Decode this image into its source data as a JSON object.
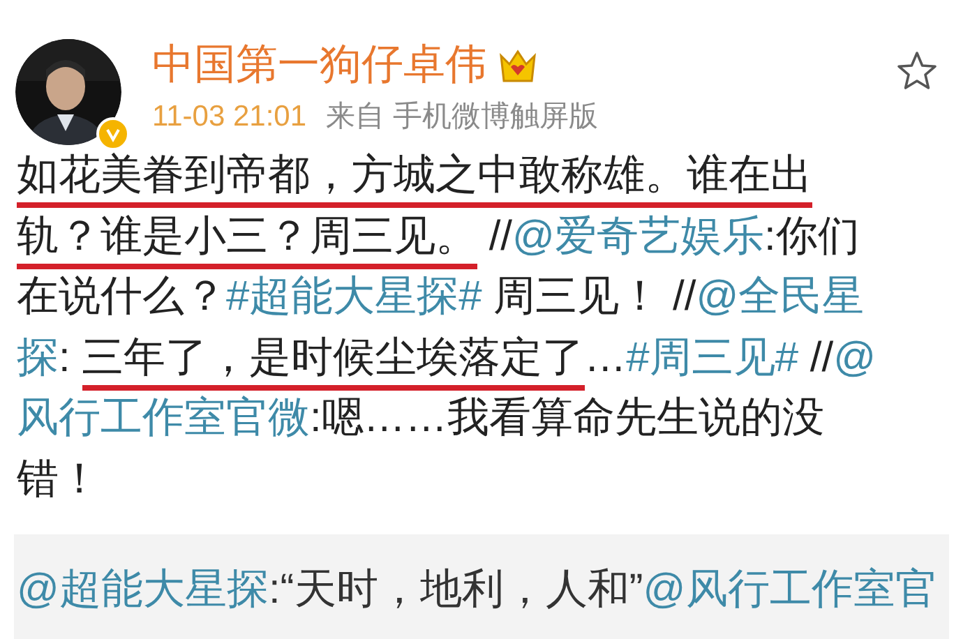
{
  "post": {
    "author": "中国第一狗仔卓伟",
    "time": "11-03 21:01",
    "source": "来自 手机微博触屏版",
    "verified": true,
    "lines": [
      [
        {
          "kind": "text",
          "text": "如花美眷到帝都，方城之中敢称雄。谁在出",
          "underlined": true
        }
      ],
      [
        {
          "kind": "text",
          "text": "轨？谁是小三？周三见。",
          "underlined": true
        },
        {
          "kind": "text",
          "text": " //",
          "underlined": false
        },
        {
          "kind": "link",
          "text": "@爱奇艺娱乐",
          "underlined": false
        },
        {
          "kind": "text",
          "text": ":你们",
          "underlined": false
        }
      ],
      [
        {
          "kind": "text",
          "text": "在说什么？",
          "underlined": false
        },
        {
          "kind": "link",
          "text": "#超能大星探#",
          "underlined": false
        },
        {
          "kind": "text",
          "text": " 周三见！ //",
          "underlined": false
        },
        {
          "kind": "link",
          "text": "@全民星",
          "underlined": false
        }
      ],
      [
        {
          "kind": "link",
          "text": "探",
          "underlined": false
        },
        {
          "kind": "text",
          "text": ": ",
          "underlined": false
        },
        {
          "kind": "text",
          "text": "三年了，是时候尘埃落定了",
          "underlined": true
        },
        {
          "kind": "text",
          "text": "…",
          "underlined": false
        },
        {
          "kind": "link",
          "text": "#周三见#",
          "underlined": false
        },
        {
          "kind": "text",
          "text": " //",
          "underlined": false
        },
        {
          "kind": "link",
          "text": "@",
          "underlined": false
        }
      ],
      [
        {
          "kind": "link",
          "text": "风行工作室官微",
          "underlined": false
        },
        {
          "kind": "text",
          "text": ":嗯……我看算命先生说的没",
          "underlined": false
        }
      ],
      [
        {
          "kind": "text",
          "text": "错！",
          "underlined": false
        }
      ]
    ],
    "repost_lines": [
      [
        {
          "kind": "link",
          "text": "@超能大星探",
          "underlined": false
        },
        {
          "kind": "text",
          "text": ":“天时，地利，人和”",
          "underlined": false
        },
        {
          "kind": "link",
          "text": "@风行工作室官",
          "underlined": false
        }
      ]
    ]
  }
}
